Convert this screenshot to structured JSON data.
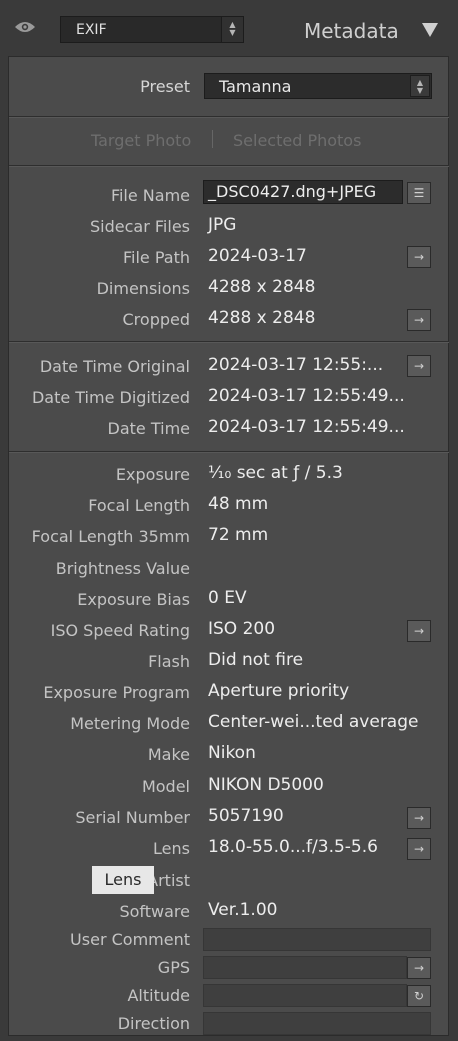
{
  "header": {
    "view_mode": "EXIF",
    "panel_title": "Metadata",
    "icons": {
      "visibility": "eye-icon",
      "collapse": "triangle-down-icon"
    }
  },
  "preset": {
    "label": "Preset",
    "value": "Tamanna"
  },
  "tabs": {
    "target": "Target Photo",
    "selected": "Selected Photos"
  },
  "fields": {
    "file_name": {
      "label": "File Name",
      "value": "_DSC0427.dng+JPEG"
    },
    "sidecar": {
      "label": "Sidecar Files",
      "value": "JPG"
    },
    "file_path": {
      "label": "File Path",
      "value": "2024-03-17"
    },
    "dimensions": {
      "label": "Dimensions",
      "value": "4288 x 2848"
    },
    "cropped": {
      "label": "Cropped",
      "value": "4288 x 2848"
    },
    "dt_original": {
      "label": "Date Time Original",
      "value": "2024-03-17 12:55:..."
    },
    "dt_digitized": {
      "label": "Date Time Digitized",
      "value": "2024-03-17 12:55:49..."
    },
    "dt": {
      "label": "Date Time",
      "value": "2024-03-17 12:55:49..."
    },
    "exposure": {
      "label": "Exposure",
      "value": "⅒ sec at ƒ / 5.3"
    },
    "focal_length": {
      "label": "Focal Length",
      "value": "48 mm"
    },
    "focal_length_35": {
      "label": "Focal Length 35mm",
      "value": "72 mm"
    },
    "brightness": {
      "label": "Brightness Value",
      "value": ""
    },
    "exposure_bias": {
      "label": "Exposure Bias",
      "value": "0 EV"
    },
    "iso": {
      "label": "ISO Speed Rating",
      "value": "ISO 200"
    },
    "flash": {
      "label": "Flash",
      "value": "Did not fire"
    },
    "exposure_program": {
      "label": "Exposure Program",
      "value": "Aperture priority"
    },
    "metering": {
      "label": "Metering Mode",
      "value": "Center-wei...ted average"
    },
    "make": {
      "label": "Make",
      "value": "Nikon"
    },
    "model": {
      "label": "Model",
      "value": "NIKON D5000"
    },
    "serial": {
      "label": "Serial Number",
      "value": "5057190"
    },
    "lens": {
      "label": "Lens",
      "value": "18.0-55.0...f/3.5-5.6"
    },
    "artist": {
      "label": "Artist",
      "value": ""
    },
    "software": {
      "label": "Software",
      "value": "Ver.1.00"
    },
    "user_comment": {
      "label": "User Comment",
      "value": ""
    },
    "gps": {
      "label": "GPS",
      "value": ""
    },
    "altitude": {
      "label": "Altitude",
      "value": ""
    },
    "direction": {
      "label": "Direction",
      "value": ""
    }
  },
  "tooltip": "Lens",
  "action_icons": {
    "go": "arrow-right-icon",
    "list": "list-icon",
    "sync": "refresh-icon"
  }
}
